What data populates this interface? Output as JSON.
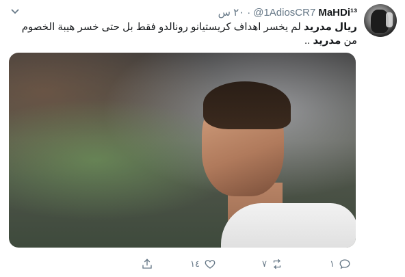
{
  "tweet": {
    "display_name": "MaHDi¹³",
    "handle": "@1AdiosCR7",
    "separator": "·",
    "time": "٢٠ س",
    "text_bold_1": "ريال مدريد",
    "text_body": " لم يخسر اهداف كريستيانو رونالدو فقط بل حتى خسر هيبة الخصوم من ",
    "text_bold_2": "مدريد",
    "text_tail": " .."
  },
  "actions": {
    "replies": "١",
    "retweets": "٧",
    "likes": "١٤"
  },
  "icons": {
    "caret": "chevron-down-icon",
    "reply": "reply-icon",
    "retweet": "retweet-icon",
    "like": "heart-icon",
    "share": "share-icon"
  },
  "colors": {
    "muted": "#657786",
    "text": "#14171a"
  }
}
